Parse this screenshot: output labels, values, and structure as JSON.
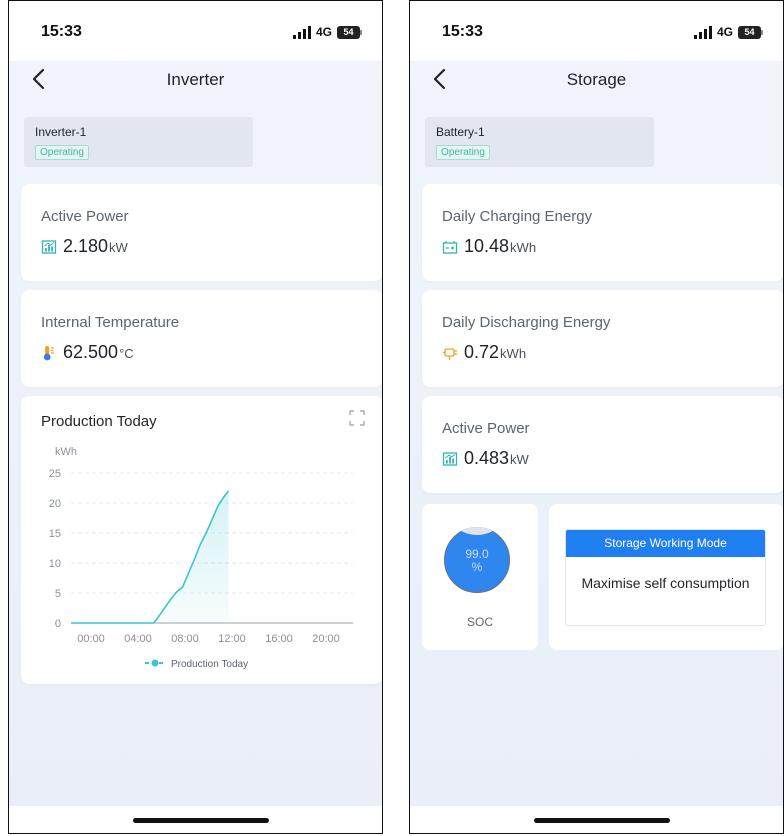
{
  "status_bar": {
    "time": "15:33",
    "network": "4G",
    "battery": "54"
  },
  "inverter": {
    "title": "Inverter",
    "device": {
      "name": "Inverter-1",
      "status": "Operating"
    },
    "active_power": {
      "label": "Active Power",
      "value": "2.180",
      "unit": "kW"
    },
    "internal_temperature": {
      "label": "Internal Temperature",
      "value": "62.500",
      "unit": "°C"
    },
    "production": {
      "title": "Production Today",
      "y_unit": "kWh",
      "legend": "Production Today"
    }
  },
  "storage": {
    "title": "Storage",
    "device": {
      "name": "Battery-1",
      "status": "Operating"
    },
    "daily_charging": {
      "label": "Daily Charging Energy",
      "value": "10.48",
      "unit": "kWh"
    },
    "daily_discharging": {
      "label": "Daily Discharging Energy",
      "value": "0.72",
      "unit": "kWh"
    },
    "active_power": {
      "label": "Active Power",
      "value": "0.483",
      "unit": "kW"
    },
    "soc": {
      "value": "99.0",
      "unit": "%",
      "level": 0.99,
      "label": "SOC"
    },
    "working_mode": {
      "title": "Storage Working Mode",
      "value": "Maximise self consumption"
    }
  },
  "colors": {
    "accent": "#1f7ef0",
    "line": "#3cc4d2",
    "operating": "#46b5a4"
  },
  "chart_data": {
    "type": "area",
    "title": "Production Today",
    "ylabel": "kWh",
    "xlabel": "",
    "x_ticks": [
      "00:00",
      "04:00",
      "08:00",
      "12:00",
      "16:00",
      "20:00"
    ],
    "y_ticks": [
      0,
      5,
      10,
      15,
      20,
      25
    ],
    "xlim": [
      0,
      24
    ],
    "ylim": [
      0,
      25
    ],
    "grid": true,
    "legend_position": "bottom",
    "series": [
      {
        "name": "Production Today",
        "x": [
          0,
          7,
          7.25,
          7.5,
          8,
          8.5,
          9,
          9.5,
          10,
          10.5,
          11,
          11.5,
          12,
          12.5,
          13,
          13.4
        ],
        "y": [
          0,
          0,
          0.5,
          1.2,
          2.6,
          4.0,
          5.2,
          6.0,
          8.3,
          10.6,
          13.1,
          15.0,
          17.2,
          19.5,
          21.0,
          22.0
        ]
      }
    ]
  }
}
